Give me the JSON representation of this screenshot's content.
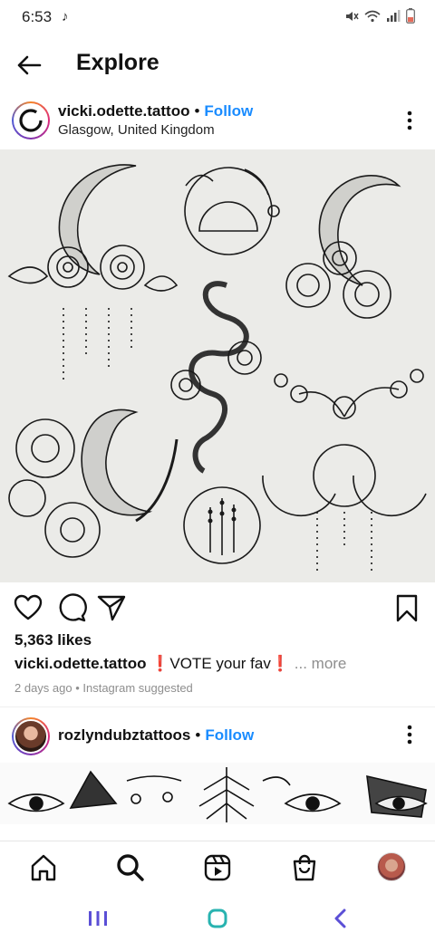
{
  "status": {
    "time": "6:53",
    "icons": [
      "tiktok-icon",
      "mute-icon",
      "wifi-icon",
      "signal-icon",
      "battery-icon"
    ]
  },
  "header": {
    "title": "Explore",
    "back_icon": "arrow-left-icon"
  },
  "post": {
    "username": "vicki.odette.tattoo",
    "separator": "•",
    "follow_label": "Follow",
    "location": "Glasgow, United Kingdom",
    "image_description_icons": [
      "crescent-moon",
      "roses",
      "sun-wreath",
      "snake",
      "peonies",
      "lavender-circle",
      "triple-moon"
    ],
    "actions": [
      "heart-icon",
      "comment-icon",
      "share-icon",
      "bookmark-icon"
    ],
    "likes": "5,363 likes",
    "caption_user": "vicki.odette.tattoo",
    "caption_mark": "❗",
    "caption_text": "VOTE your fav",
    "caption_more": "... more",
    "meta": "2 days ago • Instagram suggested"
  },
  "post2": {
    "username": "rozlyndubztattoos",
    "separator": "•",
    "follow_label": "Follow"
  },
  "tabbar": {
    "items": [
      "home-icon",
      "search-icon",
      "reels-icon",
      "shop-icon",
      "profile-avatar"
    ]
  },
  "colors": {
    "follow": "#1a8cff",
    "caption_mark": "#e0101e",
    "muted": "#8e8e8e",
    "sys_nav": "#5b4fd6",
    "sys_home": "#28b3b0"
  }
}
